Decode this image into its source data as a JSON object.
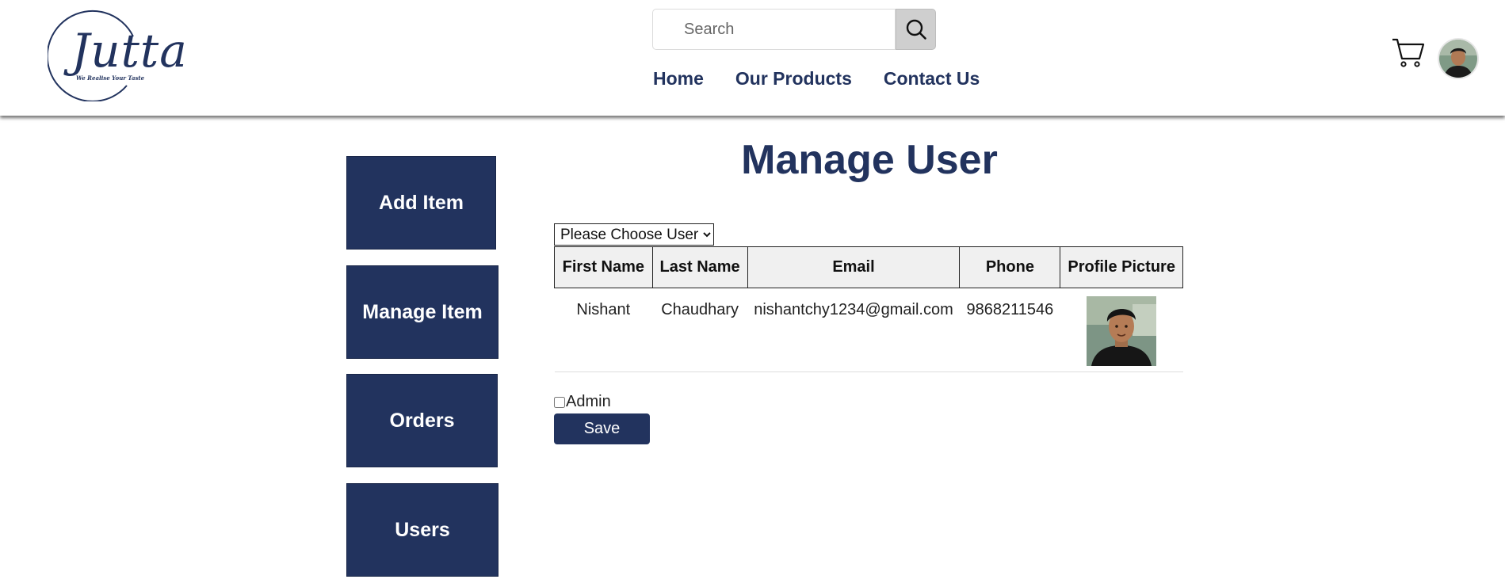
{
  "brand": {
    "name": "Jutta",
    "tagline": "We Realise Your Taste"
  },
  "search": {
    "placeholder": "Search"
  },
  "nav": {
    "home": "Home",
    "products": "Our Products",
    "contact": "Contact Us"
  },
  "sidebar": {
    "items": [
      {
        "label": "Add Item"
      },
      {
        "label": "Manage Item"
      },
      {
        "label": "Orders"
      },
      {
        "label": "Users"
      }
    ]
  },
  "main": {
    "title": "Manage User",
    "select": {
      "selected": "Please Choose User"
    },
    "table": {
      "headers": {
        "first": "First Name",
        "last": "Last Name",
        "email": "Email",
        "phone": "Phone",
        "picture": "Profile Picture"
      },
      "rows": [
        {
          "first": "Nishant",
          "last": "Chaudhary",
          "email": "nishantchy1234@gmail.com",
          "phone": "9868211546"
        }
      ]
    },
    "admin_label": "Admin",
    "admin_checked": false,
    "save_label": "Save"
  },
  "colors": {
    "brand": "#22335e",
    "header_bg": "#ffffff",
    "table_header_bg": "#f0f0f0"
  }
}
